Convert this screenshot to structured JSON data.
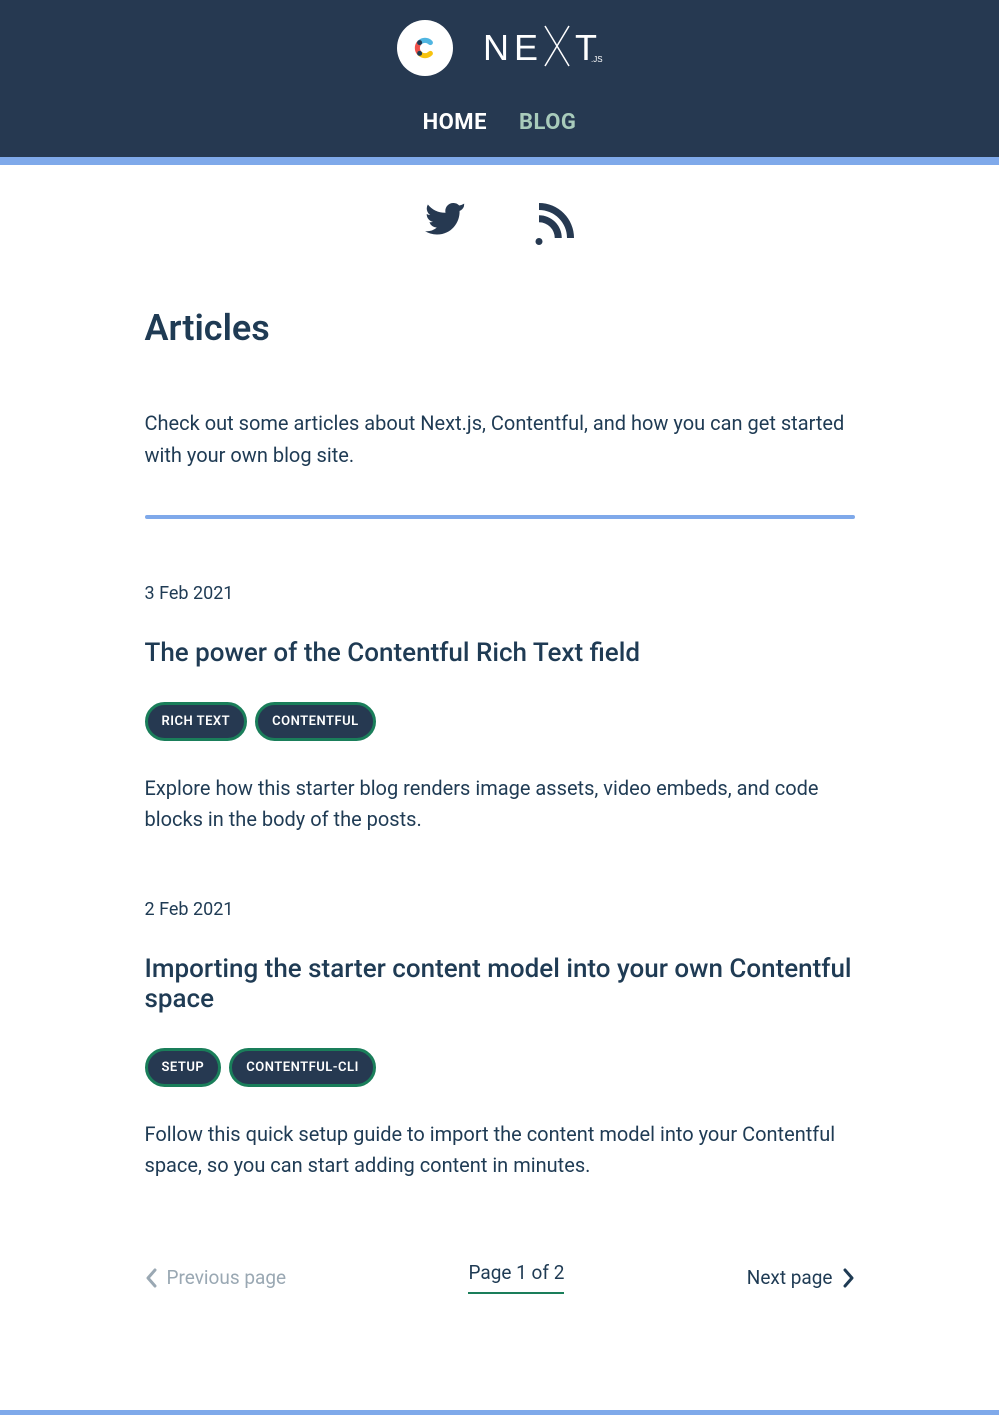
{
  "nav": {
    "home": "HOME",
    "blog": "BLOG"
  },
  "page": {
    "title": "Articles",
    "intro": "Check out some articles about Next.js, Contentful, and how you can get started with your own blog site."
  },
  "posts": [
    {
      "date": "3 Feb 2021",
      "title": "The power of the Contentful Rich Text field",
      "tags": [
        "RICH TEXT",
        "CONTENTFUL"
      ],
      "excerpt": "Explore how this starter blog renders image assets, video embeds, and code blocks in the body of the posts."
    },
    {
      "date": "2 Feb 2021",
      "title": "Importing the starter content model into your own Contentful space",
      "tags": [
        "SETUP",
        "CONTENTFUL-CLI"
      ],
      "excerpt": "Follow this quick setup guide to import the content model into your Contentful space, so you can start adding content in minutes."
    }
  ],
  "pagination": {
    "prev": "Previous page",
    "indicator": "Page 1 of 2",
    "next": "Next page"
  }
}
